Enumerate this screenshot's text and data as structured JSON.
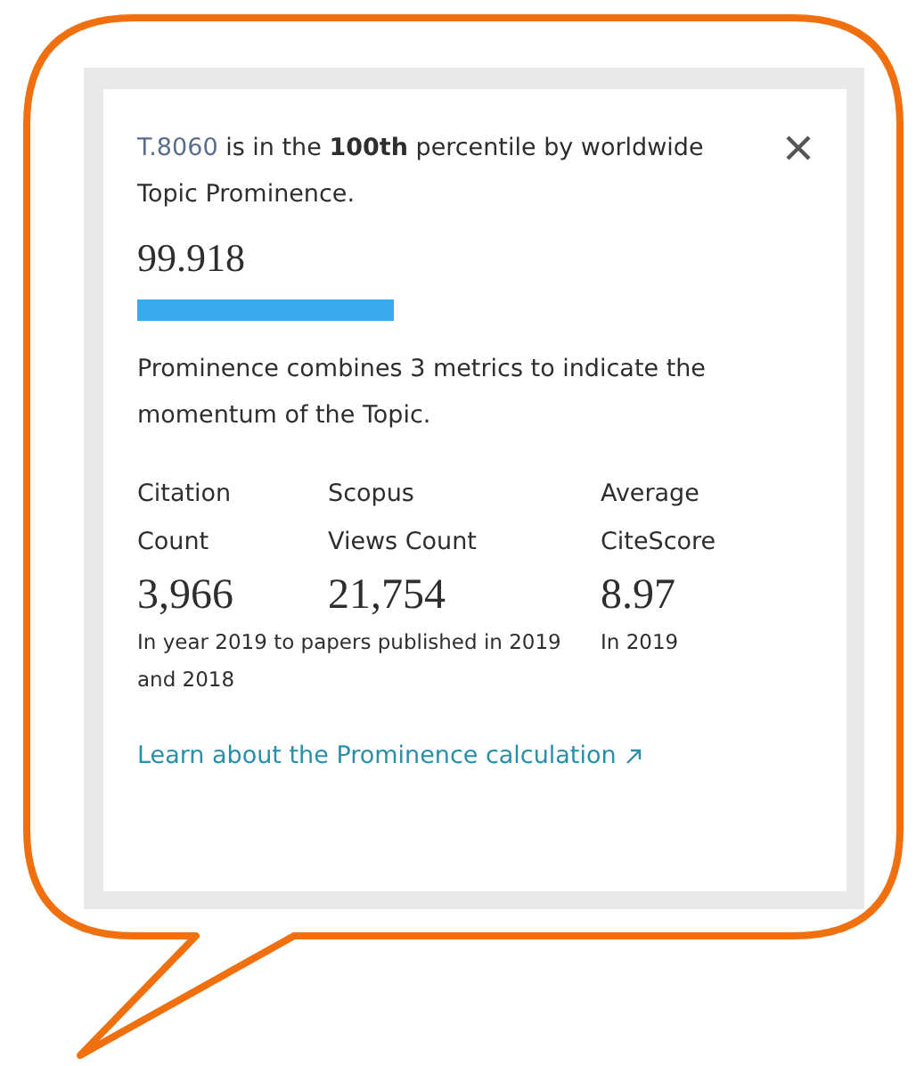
{
  "popup": {
    "topic_id": "T.8060",
    "sentence": " is in the **100th** percentile by worldwide Topic Prominence.",
    "score": "99.918",
    "description": "Prominence combines 3 metrics to indicate the momentum of the Topic.",
    "metrics": [
      {
        "label": "Citation Count",
        "value": "3,966"
      },
      {
        "label": "Scopus Views Count",
        "value": "21,754"
      },
      {
        "label": "Average CiteScore",
        "value": "8.97"
      }
    ],
    "notes": [
      "In year 2019 to papers published in 2019 and 2018",
      "In 2019"
    ],
    "link": "Learn about the Prominence calculation"
  }
}
